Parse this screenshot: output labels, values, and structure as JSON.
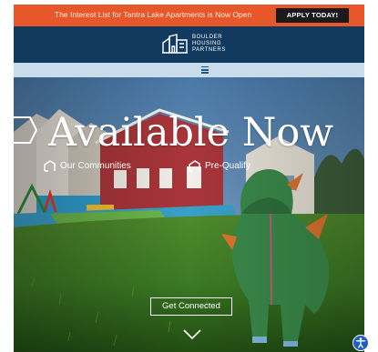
{
  "announcement": {
    "text": "The Interest List for Tantra Lake Apartments is Now Open",
    "cta_label": "APPLY TODAY!",
    "bg_color": "#e8572a"
  },
  "header": {
    "logo_lines": [
      "BOULDER",
      "HOUSING",
      "PARTNERS"
    ],
    "bg_color": "#123a5e",
    "logo_icon": "building-outline-icon"
  },
  "menu": {
    "icon": "hamburger-menu-icon",
    "bg_color": "#c9dcec"
  },
  "hero": {
    "title": "Available Now",
    "links": [
      {
        "label": "Our Communities",
        "icon": "house-outline-icon"
      },
      {
        "label": "Pre-Qualify",
        "icon": "house-outline-icon"
      }
    ],
    "cta_label": "Get Connected",
    "scroll_icon": "chevron-down-icon"
  },
  "accessibility": {
    "icon": "accessibility-icon"
  }
}
